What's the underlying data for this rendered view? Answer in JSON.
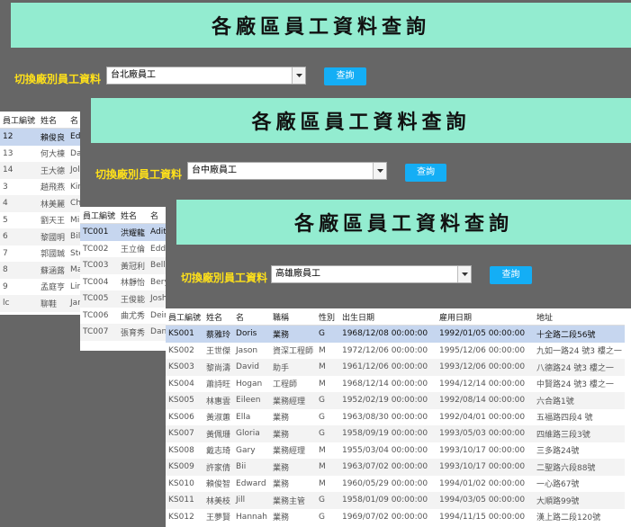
{
  "windows": [
    {
      "title": "各廠區員工資料查詢",
      "switch_label": "切換廠別員工資料",
      "factory_select": "台北廠員工",
      "query_button": "查詢",
      "columns": [
        "員工編號",
        "姓名",
        "名"
      ],
      "rows": [
        [
          "12",
          "賴俊良",
          "Ed"
        ],
        [
          "13",
          "何大棟",
          "Da"
        ],
        [
          "14",
          "王大德",
          "Jol"
        ],
        [
          "3",
          "趙飛燕",
          "Kir"
        ],
        [
          "4",
          "林美麗",
          "Ch"
        ],
        [
          "5",
          "劉天王",
          "Mi"
        ],
        [
          "6",
          "黎國明",
          "Bil"
        ],
        [
          "7",
          "郭國臹",
          "Ste"
        ],
        [
          "8",
          "蘇涵蕗",
          "Ma"
        ],
        [
          "9",
          "孟庭亨",
          "Lin"
        ],
        [
          "lc",
          "聊鞋",
          "Jar"
        ]
      ]
    },
    {
      "title": "各廠區員工資料查詢",
      "switch_label": "切換廠別員工資料",
      "factory_select": "台中廠員工",
      "query_button": "查詢",
      "columns": [
        "員工編號",
        "姓名",
        "名"
      ],
      "rows": [
        [
          "TC001",
          "洪耀龍",
          "Adit"
        ],
        [
          "TC002",
          "王立倫",
          "Edd"
        ],
        [
          "TC003",
          "黃冠利",
          "Bella"
        ],
        [
          "TC004",
          "林靜怡",
          "Bery"
        ],
        [
          "TC005",
          "王俊能",
          "Josh"
        ],
        [
          "TC006",
          "曲尤秀",
          "Deir"
        ],
        [
          "TC007",
          "張育秀",
          "Dan"
        ]
      ]
    },
    {
      "title": "各廠區員工資料查詢",
      "switch_label": "切換廠別員工資料",
      "factory_select": "高雄廠員工",
      "query_button": "查詢",
      "columns": [
        "員工編號",
        "姓名",
        "名",
        "職稱",
        "性別",
        "出生日期",
        "雇用日期",
        "地址"
      ],
      "rows": [
        [
          "KS001",
          "蔡雅玲",
          "Doris",
          "業務",
          "G",
          "1968/12/08 00:00:00",
          "1992/01/05 00:00:00",
          "十全路二段56號"
        ],
        [
          "KS002",
          "王世傑",
          "Jason",
          "資深工程師",
          "M",
          "1972/12/06 00:00:00",
          "1995/12/06 00:00:00",
          "九如一路24 號3 樓之一"
        ],
        [
          "KS003",
          "黎尚濤",
          "David",
          "助手",
          "M",
          "1961/12/06 00:00:00",
          "1993/12/06 00:00:00",
          "八德路24 號3 樓之一"
        ],
        [
          "KS004",
          "蕭詩旺",
          "Hogan",
          "工程師",
          "M",
          "1968/12/14 00:00:00",
          "1994/12/14 00:00:00",
          "中賢路24 號3 樓之一"
        ],
        [
          "KS005",
          "林惠雲",
          "Eileen",
          "業務經理",
          "G",
          "1952/02/19 00:00:00",
          "1992/08/14 00:00:00",
          "六合路1號"
        ],
        [
          "KS006",
          "黃淑蕙",
          "Ella",
          "業務",
          "G",
          "1963/08/30 00:00:00",
          "1992/04/01 00:00:00",
          "五福路四段4 號"
        ],
        [
          "KS007",
          "黃佩珊",
          "Gloria",
          "業務",
          "G",
          "1958/09/19 00:00:00",
          "1993/05/03 00:00:00",
          "四維路三段3號"
        ],
        [
          "KS008",
          "戴志琦",
          "Gary",
          "業務經理",
          "M",
          "1955/03/04 00:00:00",
          "1993/10/17 00:00:00",
          "三多路24號"
        ],
        [
          "KS009",
          "許家倩",
          "Bii",
          "業務",
          "M",
          "1963/07/02 00:00:00",
          "1993/10/17 00:00:00",
          "二聖路六段88號"
        ],
        [
          "KS010",
          "賴俊智",
          "Edward",
          "業務",
          "M",
          "1960/05/29 00:00:00",
          "1994/01/02 00:00:00",
          "一心路67號"
        ],
        [
          "KS011",
          "林美枝",
          "Jill",
          "業務主管",
          "G",
          "1958/01/09 00:00:00",
          "1994/03/05 00:00:00",
          "大順路99號"
        ],
        [
          "KS012",
          "王夢賢",
          "Hannah",
          "業務",
          "G",
          "1969/07/02 00:00:00",
          "1994/11/15 00:00:00",
          "漢上路二段120號"
        ]
      ]
    }
  ]
}
